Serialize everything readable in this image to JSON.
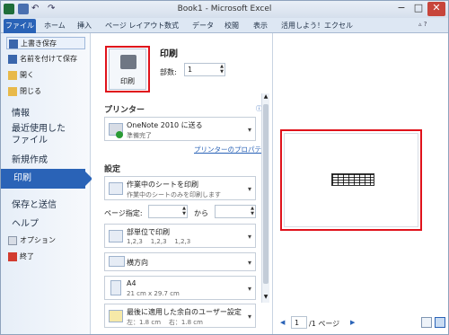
{
  "window": {
    "title": "Book1 - Microsoft Excel",
    "controls": {
      "minimize": "−",
      "maximize": "□",
      "close": "✕"
    }
  },
  "ribbon": {
    "tabs": [
      "ファイル",
      "ホーム",
      "挿入",
      "ページ レイアウト",
      "数式",
      "データ",
      "校閲",
      "表示",
      "活用しよう！エクセル"
    ]
  },
  "backstage": {
    "commands": [
      {
        "label": "上書き保存",
        "icon": "save-icon"
      },
      {
        "label": "名前を付けて保存",
        "icon": "save-as-icon"
      },
      {
        "label": "開く",
        "icon": "open-folder-icon"
      },
      {
        "label": "閉じる",
        "icon": "close-folder-icon"
      }
    ],
    "sections": {
      "info": "情報",
      "recent": "最近使用した\nファイル",
      "new": "新規作成",
      "print": "印刷",
      "share": "保存と送信",
      "help": "ヘルプ"
    },
    "options": "オプション",
    "exit": "終了"
  },
  "print": {
    "heading": "印刷",
    "button_label": "印刷",
    "copies_label": "部数:",
    "copies_value": "1"
  },
  "printer": {
    "heading": "プリンター",
    "name": "OneNote 2010 に送る",
    "status": "準備完了",
    "properties_link": "プリンターのプロパティ"
  },
  "settings": {
    "heading": "設定",
    "scope": {
      "title": "作業中のシートを印刷",
      "subtitle": "作業中のシートのみを印刷します"
    },
    "pages_label": "ページ指定:",
    "pages_to": "から",
    "pages_from_value": "",
    "pages_to_value": "",
    "collate": {
      "title": "部単位で印刷",
      "subtitle": "1,2,3    1,2,3    1,2,3"
    },
    "orientation": {
      "title": "横方向"
    },
    "paper": {
      "title": "A4",
      "subtitle": "21 cm x 29.7 cm"
    },
    "margins": {
      "title": "最後に適用した余白のユーザー設定",
      "subtitle": "左：1.8 cm    右：1.8 cm"
    }
  },
  "preview": {
    "page_value": "1",
    "page_total": "/1 ページ"
  },
  "colors": {
    "accent": "#2a63b7",
    "highlight": "#e0121b"
  }
}
